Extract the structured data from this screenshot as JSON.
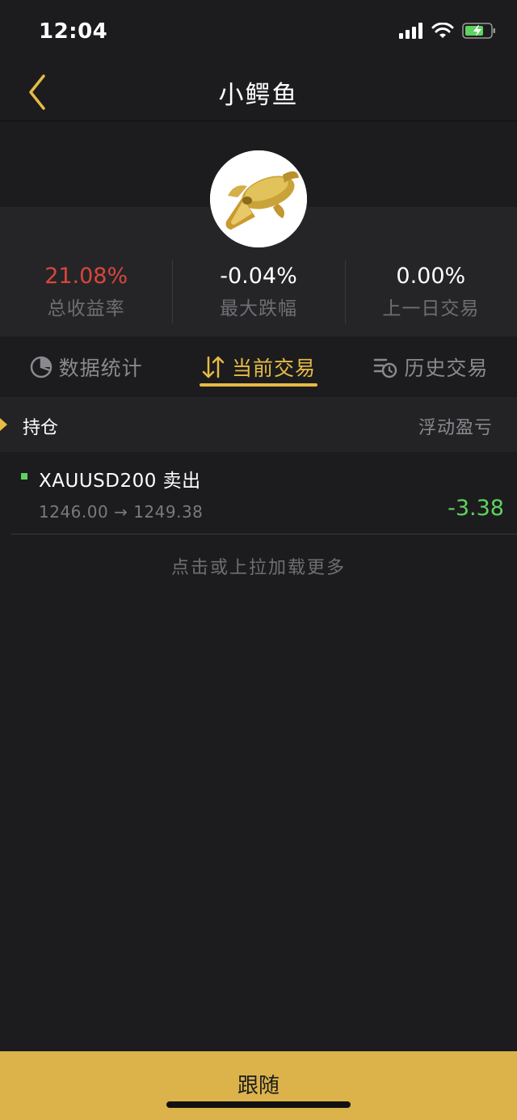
{
  "status_bar": {
    "time": "12:04"
  },
  "nav": {
    "title": "小鳄鱼"
  },
  "stats": [
    {
      "value": "21.08%",
      "label": "总收益率",
      "color": "#d9463b"
    },
    {
      "value": "-0.04%",
      "label": "最大跌幅",
      "color": "#ffffff"
    },
    {
      "value": "0.00%",
      "label": "上一日交易",
      "color": "#ffffff"
    }
  ],
  "tabs": [
    {
      "label": "数据统计",
      "icon": "pie-chart-icon",
      "active": false
    },
    {
      "label": "当前交易",
      "icon": "swap-arrows-icon",
      "active": true
    },
    {
      "label": "历史交易",
      "icon": "history-list-icon",
      "active": false
    }
  ],
  "section": {
    "title": "持仓",
    "right_label": "浮动盈亏"
  },
  "positions": [
    {
      "symbol": "XAUUSD200 卖出",
      "open_price": "1246.00",
      "arrow": "→",
      "current_price": "1249.38",
      "pnl": "-3.38"
    }
  ],
  "load_more": "点击或上拉加载更多",
  "follow_button": "跟随",
  "colors": {
    "accent": "#e6bb45",
    "positive_green": "#5fd25f",
    "negative_red": "#d9463b",
    "button_gold": "#dcb34a"
  }
}
